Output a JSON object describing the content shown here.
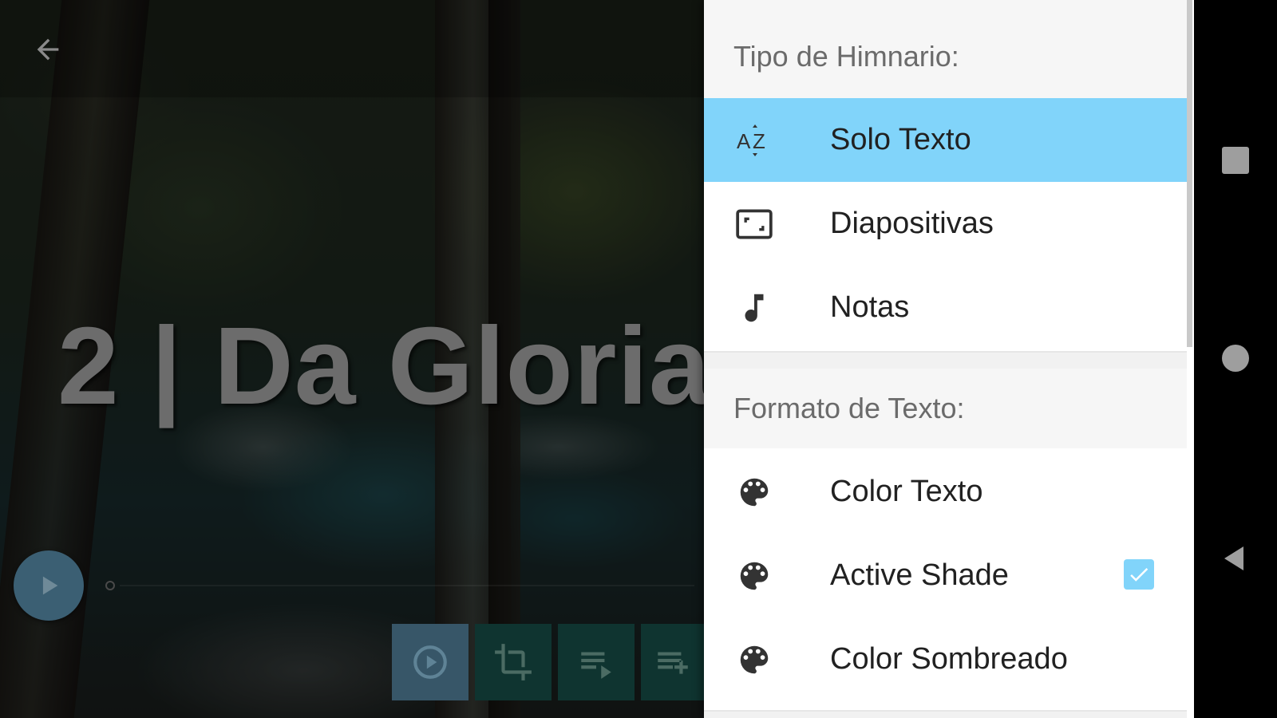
{
  "player": {
    "song_title": "2 | Da Gloria"
  },
  "drawer": {
    "section_hymnal_type": "Tipo de Himnario:",
    "hymnal_items": [
      {
        "label": "Solo Texto",
        "icon": "sort-az-icon",
        "selected": true
      },
      {
        "label": "Diapositivas",
        "icon": "slideshow-icon",
        "selected": false
      },
      {
        "label": "Notas",
        "icon": "music-note-icon",
        "selected": false
      }
    ],
    "section_text_format": "Formato de Texto:",
    "format_items": [
      {
        "label": "Color Texto",
        "icon": "palette-icon"
      },
      {
        "label": "Active Shade",
        "icon": "palette-icon",
        "checked": true
      },
      {
        "label": "Color Sombreado",
        "icon": "palette-icon"
      }
    ]
  },
  "colors": {
    "selected_item_bg": "#81d4fa",
    "toolbar_active": "#375668",
    "toolbar_dark": "#0f3430"
  }
}
